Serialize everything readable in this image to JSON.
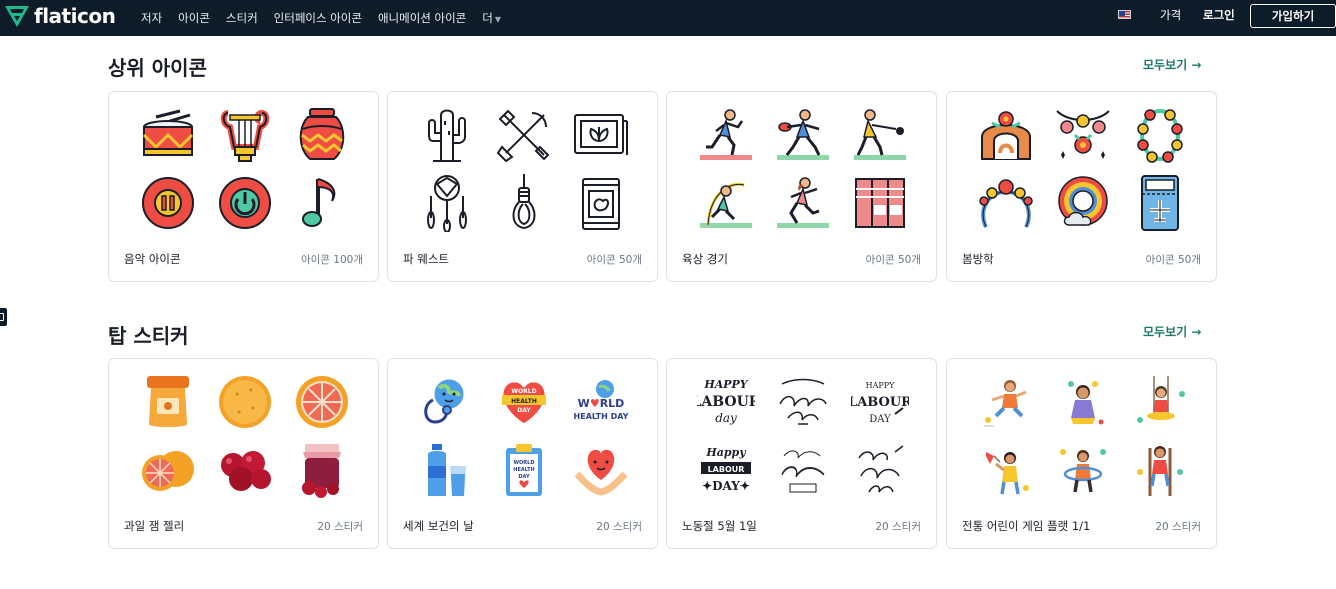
{
  "header": {
    "logo_text": "flaticon",
    "nav": [
      "저자",
      "아이콘",
      "스티커",
      "인터페이스 아이콘",
      "애니메이션 아이콘",
      "더"
    ],
    "price": "가격",
    "login": "로그인",
    "signup": "가입하기"
  },
  "sections": [
    {
      "title": "상위 아이콘",
      "see_all": "모두보기 →",
      "cards": [
        {
          "name": "음악 아이콘",
          "count": "아이콘 100개",
          "icons": [
            "drum-icon",
            "lyre-icon",
            "vase-icon",
            "pause-button-icon",
            "power-button-icon",
            "music-note-icon"
          ]
        },
        {
          "name": "파 웨스트",
          "count": "아이콘 50개",
          "icons": [
            "cactus-icon",
            "crossed-shovel-pickaxe-icon",
            "framed-plant-icon",
            "dreamcatcher-icon",
            "noose-icon",
            "bean-can-icon"
          ]
        },
        {
          "name": "육상 경기",
          "count": "아이콘 50개",
          "icons": [
            "runner-icon",
            "discus-thrower-icon",
            "hammer-thrower-icon",
            "pole-vaulter-icon",
            "sprinter-icon",
            "running-track-icon"
          ]
        },
        {
          "name": "봄방학",
          "count": "아이콘 50개",
          "icons": [
            "flower-arch-icon",
            "flower-garland-icon",
            "flower-lei-icon",
            "flower-headband-icon",
            "rainbow-icon",
            "boarding-pass-icon"
          ]
        }
      ]
    },
    {
      "title": "탑 스티커",
      "see_all": "모두보기 →",
      "cards": [
        {
          "name": "과일 잼 젤리",
          "count": "20 스티커",
          "icons": [
            "jam-jar-sticker",
            "orange-sticker",
            "grapefruit-slice-sticker",
            "grapefruit-sticker",
            "cherries-sticker",
            "berry-jar-sticker"
          ]
        },
        {
          "name": "세계 보건의 날",
          "count": "20 스티커",
          "icons": [
            "earth-stethoscope-sticker",
            "world-health-day-heart-sticker",
            "world-health-day-text-sticker",
            "water-bottle-sticker",
            "clipboard-sticker",
            "heart-hands-sticker"
          ]
        },
        {
          "name": "노동절 5월 1일",
          "count": "20 스티커",
          "icons": [
            "happy-labour-day-1-sticker",
            "happy-labour-day-2-sticker",
            "happy-labour-day-3-sticker",
            "happy-labour-day-4-sticker",
            "happy-labour-day-5-sticker",
            "happy-labour-day-6-sticker"
          ]
        },
        {
          "name": "전통 어린이 게임 플랫 1/1",
          "count": "20 스티커",
          "icons": [
            "hopscotch-kid-sticker",
            "marbles-kid-sticker",
            "swing-kid-sticker",
            "pinwheel-kid-sticker",
            "hoop-kid-sticker",
            "stilts-kid-sticker"
          ]
        }
      ]
    }
  ],
  "lettering": {
    "world_health_day": "WORLD HEALTH DAY",
    "happy": "HAPPY",
    "labour": "LABOUR",
    "day": "day"
  },
  "colors": {
    "topbar": "#0e1c2a",
    "accent": "#1d7a68",
    "icon_red": "#ef4d43",
    "icon_yellow": "#f7c62f",
    "icon_teal": "#4fc9a3"
  }
}
